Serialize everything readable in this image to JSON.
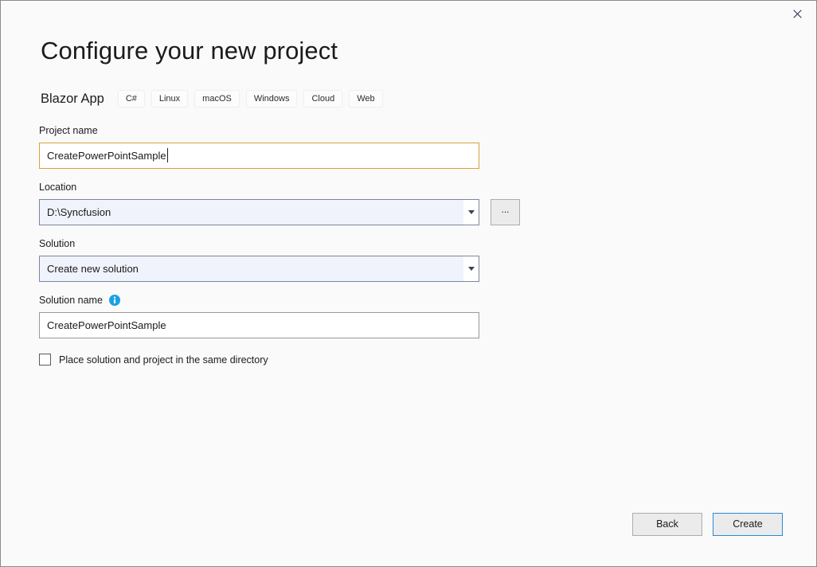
{
  "dialog": {
    "title": "Configure your new project",
    "close_label": "Close",
    "close_icon": "close-icon"
  },
  "template": {
    "name": "Blazor App",
    "tags": [
      "C#",
      "Linux",
      "macOS",
      "Windows",
      "Cloud",
      "Web"
    ]
  },
  "fields": {
    "project_name": {
      "label": "Project name",
      "value": "CreatePowerPointSample",
      "placeholder": "",
      "focused": true
    },
    "location": {
      "label": "Location",
      "value": "D:\\Syncfusion",
      "browse_label": "...",
      "dropdown_icon": "chevron-down-icon"
    },
    "solution": {
      "label": "Solution",
      "value": "Create new solution",
      "dropdown_icon": "chevron-down-icon"
    },
    "solution_name": {
      "label": "Solution name",
      "value": "CreatePowerPointSample",
      "placeholder": "",
      "info_icon": "info-icon"
    },
    "same_directory": {
      "label": "Place solution and project in the same directory",
      "checked": false
    }
  },
  "footer": {
    "back_label": "Back",
    "create_label": "Create"
  },
  "colors": {
    "dialog_bg": "#fafafa",
    "dialog_border": "#8a8a8a",
    "text": "#1b1b1b",
    "focus_border": "#d7a33a",
    "input_border": "#9a9a9a",
    "combo_bg": "#f0f3fb",
    "combo_border": "#7a86a0",
    "button_bg": "#ebebeb",
    "button_border": "#adadad",
    "primary_border": "#2a8ad4",
    "info_blue": "#1ba1e2"
  }
}
